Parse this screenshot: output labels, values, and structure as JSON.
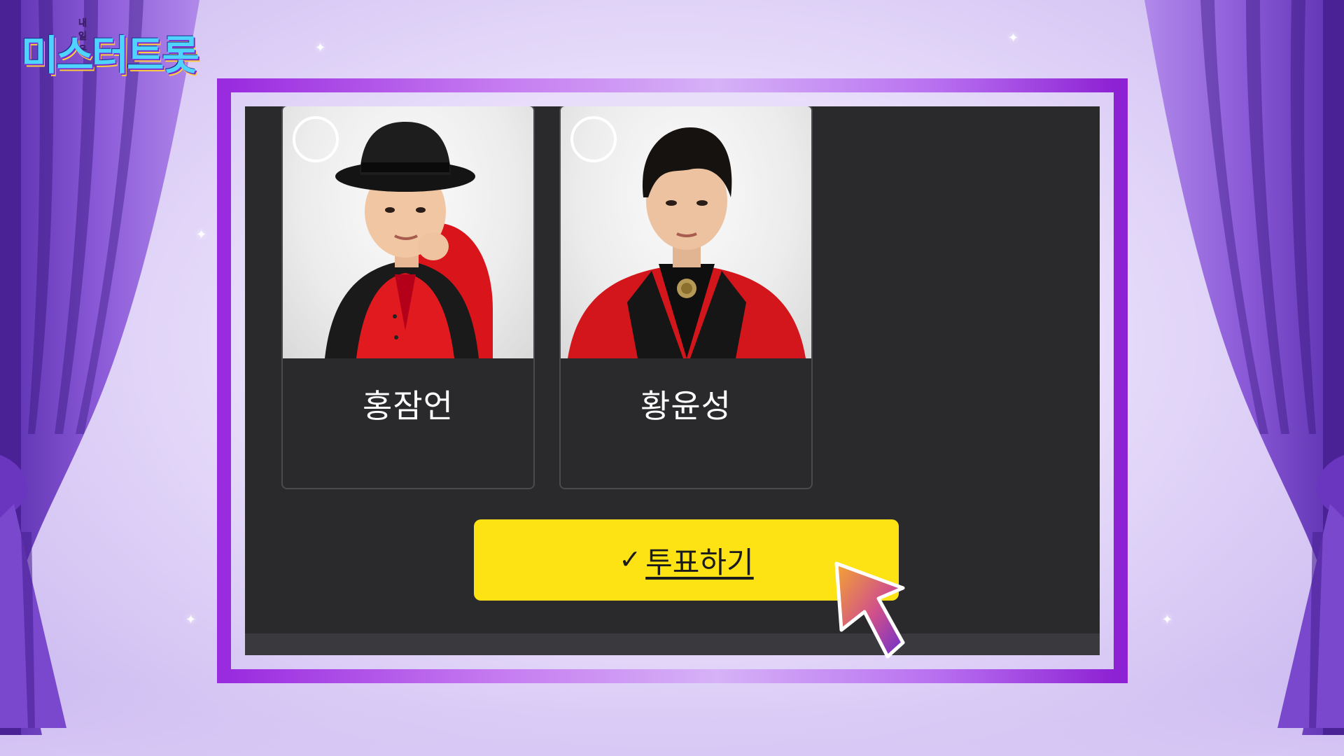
{
  "logo": {
    "small_text": "내일은",
    "main_text": "미스터트롯"
  },
  "candidates": [
    {
      "name": "홍잠언",
      "selected": false
    },
    {
      "name": "황윤성",
      "selected": false
    }
  ],
  "vote_button": {
    "check": "✓",
    "label": "투표하기"
  },
  "colors": {
    "accent_yellow": "#fde313",
    "frame_purple": "#a430de",
    "panel_dark": "#2a2a2d",
    "curtain_purple": "#8a55d6"
  },
  "icons": {
    "cursor": "pointer-arrow-icon",
    "radio": "radio-circle-icon",
    "check": "check-icon"
  }
}
